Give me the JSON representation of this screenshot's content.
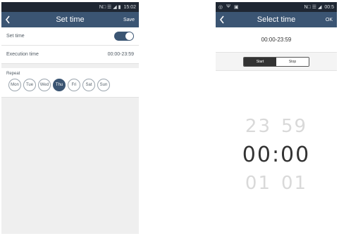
{
  "set_time_screen": {
    "status": {
      "icons": "N□ ☰ ◢ ▮",
      "time": "15:02"
    },
    "title": "Set time",
    "back_glyph": "<",
    "save_label": "Save",
    "set_time_label": "Set time",
    "set_time_enabled": true,
    "execution_time_label": "Execution time",
    "execution_time_value": "00:00-23:59",
    "repeat_label": "Repeat",
    "days": [
      "Mon",
      "Tue",
      "Wed",
      "Thu",
      "Fri",
      "Sat",
      "Sun"
    ],
    "selected_day": "Thu"
  },
  "select_time_screen": {
    "status": {
      "left_icons": [
        "◎",
        "Ψ",
        "▣"
      ],
      "icons": "N□ ☰ ◢",
      "time": "00:5"
    },
    "title": "Select time",
    "back_glyph": "<",
    "ok_label": "OK",
    "range": "00:00-23:59",
    "segments": [
      "Start",
      "Stop"
    ],
    "active_segment": "Start",
    "picker": {
      "prev": {
        "hour": "23",
        "minute": "59"
      },
      "current": {
        "hour": "00",
        "minute": "00"
      },
      "next": {
        "hour": "01",
        "minute": "01"
      }
    }
  },
  "colors": {
    "titlebar": "#3b5573",
    "statusbar": "#1f2733",
    "accent": "#3b5573"
  }
}
